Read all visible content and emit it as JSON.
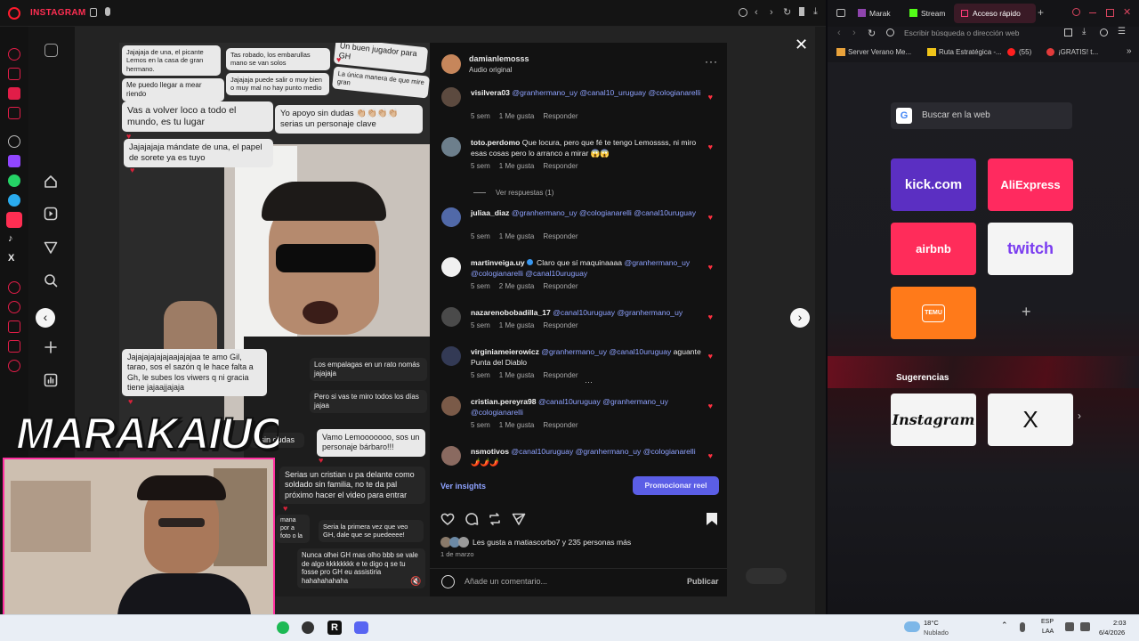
{
  "browser_left": {
    "app_title": "INSTAGRAM",
    "icons": [
      "lock-icon",
      "mic-icon",
      "settings-icon",
      "back-icon",
      "forward-icon",
      "reload-icon",
      "pin-icon",
      "download-icon"
    ]
  },
  "post": {
    "username": "damianlemosss",
    "audio": "Audio original",
    "video_chats": [
      {
        "text": "Jajajaja de una, el picante Lemos en la casa de gran hermano."
      },
      {
        "text": "Tas robado, los embarullas mano se van solos"
      },
      {
        "text": "Un buen jugador para GH"
      },
      {
        "text": "La única manera de que mire gran"
      },
      {
        "text": "Me puedo llegar a mear riendo"
      },
      {
        "text": "Jajajaja puede salir o muy bien o muy mal no hay punto medio"
      },
      {
        "text": "Vas a volver loco a todo el mundo, es tu lugar"
      },
      {
        "text": "Yo apoyo sin dudas 👏🏼👏🏼👏🏼👏🏼 serias un personaje clave"
      },
      {
        "text": "Jajajajaja mándate de una, el papel de sorete ya es tuyo"
      },
      {
        "text": "Jajajajajajajaajajajaa te amo Gil, tarao, sos el sazón q le hace falta a Gh, le subes los viwers q ni gracia tiene jajaajjajaja"
      },
      {
        "text": "Los empalagas en un rato nomás jajajaja"
      },
      {
        "text": "Pero si vas te miro todos los días jajaa"
      },
      {
        "text": "g sin dudas"
      },
      {
        "text": "Vamo Lemooooooo, sos un personaje bárbaro!!!"
      },
      {
        "text": "Serias un cristian u pa delante como soldado sin familia, no te da pal próximo hacer el video para entrar"
      },
      {
        "text": "mana por a foto o la"
      },
      {
        "text": "Seria la primera vez que veo GH, dale que se puedeeee!"
      },
      {
        "text": "Nunca olhei GH mas olho bbb se vale de algo kkkkkkkk e te digo q se tu fosse pro GH eu assistiria hahahahahaha"
      }
    ],
    "comments": [
      {
        "user": "visilvera03",
        "text": "",
        "tags": "@granhermano_uy @canal10_uruguay @cologianarelli",
        "time": "5 sem",
        "likes": "1 Me gusta",
        "reply": "Responder"
      },
      {
        "user": "toto.perdomo",
        "text": "Que locura, pero que fé te tengo Lemossss, ni miro esas cosas pero lo arranco a mirar 😱😱",
        "tags": "",
        "time": "5 sem",
        "likes": "1 Me gusta",
        "reply": "Responder"
      },
      {
        "user": "juliaa_diaz",
        "text": "",
        "tags": "@granhermano_uy @cologianarelli @canal10uruguay",
        "time": "5 sem",
        "likes": "1 Me gusta",
        "reply": "Responder"
      },
      {
        "user": "martinveiga.uy",
        "text": "Claro que sí maquinaaaa",
        "tags": "@granhermano_uy @cologianarelli @canal10uruguay",
        "time": "5 sem",
        "likes": "2 Me gusta",
        "reply": "Responder"
      },
      {
        "user": "nazarenobobadilla_17",
        "text": "",
        "tags": "@canal10uruguay @granhermano_uy",
        "time": "5 sem",
        "likes": "1 Me gusta",
        "reply": "Responder"
      },
      {
        "user": "virginiameierowicz",
        "text": "aguante Punta del Diablo",
        "tags": "@granhermano_uy @canal10uruguay",
        "time": "5 sem",
        "likes": "1 Me gusta",
        "reply": "Responder"
      },
      {
        "user": "cristian.pereyra98",
        "text": "",
        "tags": "@canal10uruguay @granhermano_uy @cologianarelli",
        "time": "5 sem",
        "likes": "1 Me gusta",
        "reply": "Responder"
      },
      {
        "user": "nsmotivos",
        "text": "🌶️🌶️🌶️",
        "tags": "@canal10uruguay @granhermano_uy @cologianarelli",
        "time": "",
        "likes": "",
        "reply": ""
      }
    ],
    "view_replies": "Ver respuestas (1)",
    "insights": "Ver insights",
    "promote": "Promocionar reel",
    "likes_summary": "Les gusta a matiascorbo7 y 235 personas más",
    "date": "1 de marzo",
    "comment_placeholder": "Añade un comentario...",
    "publish": "Publicar"
  },
  "overlay": {
    "logo": "MARAKAIUO"
  },
  "browser_right": {
    "tabs": [
      "Marak",
      "Stream",
      "Acceso rápido"
    ],
    "address_placeholder": "Escribir búsqueda o dirección web",
    "bookmarks": [
      "Server Verano Me...",
      "Ruta Estratégica -...",
      "(55)",
      "¡GRATIS! t..."
    ],
    "search_label": "Buscar en la web",
    "speed_dials": [
      "kick.com",
      "AliExpress",
      "airbnb",
      "twitch",
      "TEMU"
    ],
    "suggestions_title": "Sugerencias",
    "suggestions": [
      "Instagram",
      "X"
    ]
  },
  "taskbar": {
    "temp": "18°C",
    "weather": "Nublado",
    "lang": "ESP",
    "region": "LAA",
    "time": "2:03",
    "date": "6/4/2026"
  },
  "colors": {
    "accent": "#7c8cff",
    "heart": "#ff3040",
    "tab_active": "#e3145a"
  }
}
